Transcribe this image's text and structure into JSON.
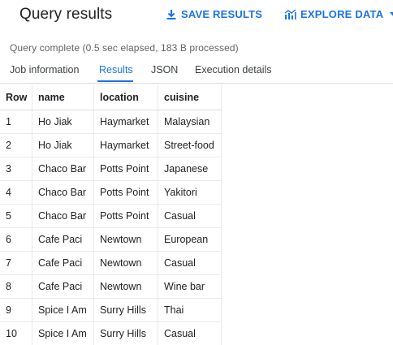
{
  "header": {
    "title": "Query results",
    "save_label": "SAVE RESULTS",
    "explore_label": "EXPLORE DATA"
  },
  "status": "Query complete (0.5 sec elapsed, 183 B processed)",
  "tabs": [
    {
      "label": "Job information",
      "active": false
    },
    {
      "label": "Results",
      "active": true
    },
    {
      "label": "JSON",
      "active": false
    },
    {
      "label": "Execution details",
      "active": false
    }
  ],
  "table": {
    "columns": [
      "Row",
      "name",
      "location",
      "cuisine"
    ],
    "rows": [
      [
        "1",
        "Ho Jiak",
        "Haymarket",
        "Malaysian"
      ],
      [
        "2",
        "Ho Jiak",
        "Haymarket",
        "Street-food"
      ],
      [
        "3",
        "Chaco Bar",
        "Potts Point",
        "Japanese"
      ],
      [
        "4",
        "Chaco Bar",
        "Potts Point",
        "Yakitori"
      ],
      [
        "5",
        "Chaco Bar",
        "Potts Point",
        "Casual"
      ],
      [
        "6",
        "Cafe Paci",
        "Newtown",
        "European"
      ],
      [
        "7",
        "Cafe Paci",
        "Newtown",
        "Casual"
      ],
      [
        "8",
        "Cafe Paci",
        "Newtown",
        "Wine bar"
      ],
      [
        "9",
        "Spice I Am",
        "Surry Hills",
        "Thai"
      ],
      [
        "10",
        "Spice I Am",
        "Surry Hills",
        "Casual"
      ]
    ]
  },
  "colors": {
    "accent": "#1a73e8",
    "text": "#202124",
    "muted": "#5f6368",
    "divider": "#dadce0"
  },
  "icons": {
    "save": "download-icon",
    "explore": "chart-icon",
    "dropdown": "caret-down-icon"
  }
}
